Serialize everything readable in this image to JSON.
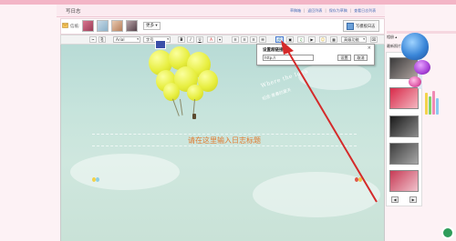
{
  "page": {
    "title": "写日志",
    "top_links": [
      "草稿箱",
      "返回列表",
      "保存为草稿",
      "查看日志列表"
    ]
  },
  "header": {
    "template_label": "信纸:",
    "more_label": "更多 ▾",
    "right_button_label": "写模板日志"
  },
  "toolbar": {
    "font_family": "Arial",
    "font_size": "字号",
    "bold": "B",
    "italic": "I",
    "underline": "U",
    "color": "A",
    "advanced_label": "高级功能"
  },
  "editor": {
    "title_placeholder": "请在这里输入日志标题",
    "script_text": "Where the Idea",
    "script_text2": "纪念·青春的夏天"
  },
  "link_popup": {
    "title": "设置超链接",
    "close": "×",
    "url_value": "http://",
    "confirm": "设置",
    "cancel": "取消"
  },
  "side": {
    "label1": "相册 ▴",
    "label2": "最新照片",
    "prev": "◀",
    "next": "▶"
  },
  "colors": {
    "pink_bar": "#f3b5c6",
    "link": "#4a6fb8",
    "title_orange": "#e07a2e",
    "arrow_red": "#d42a2a"
  }
}
